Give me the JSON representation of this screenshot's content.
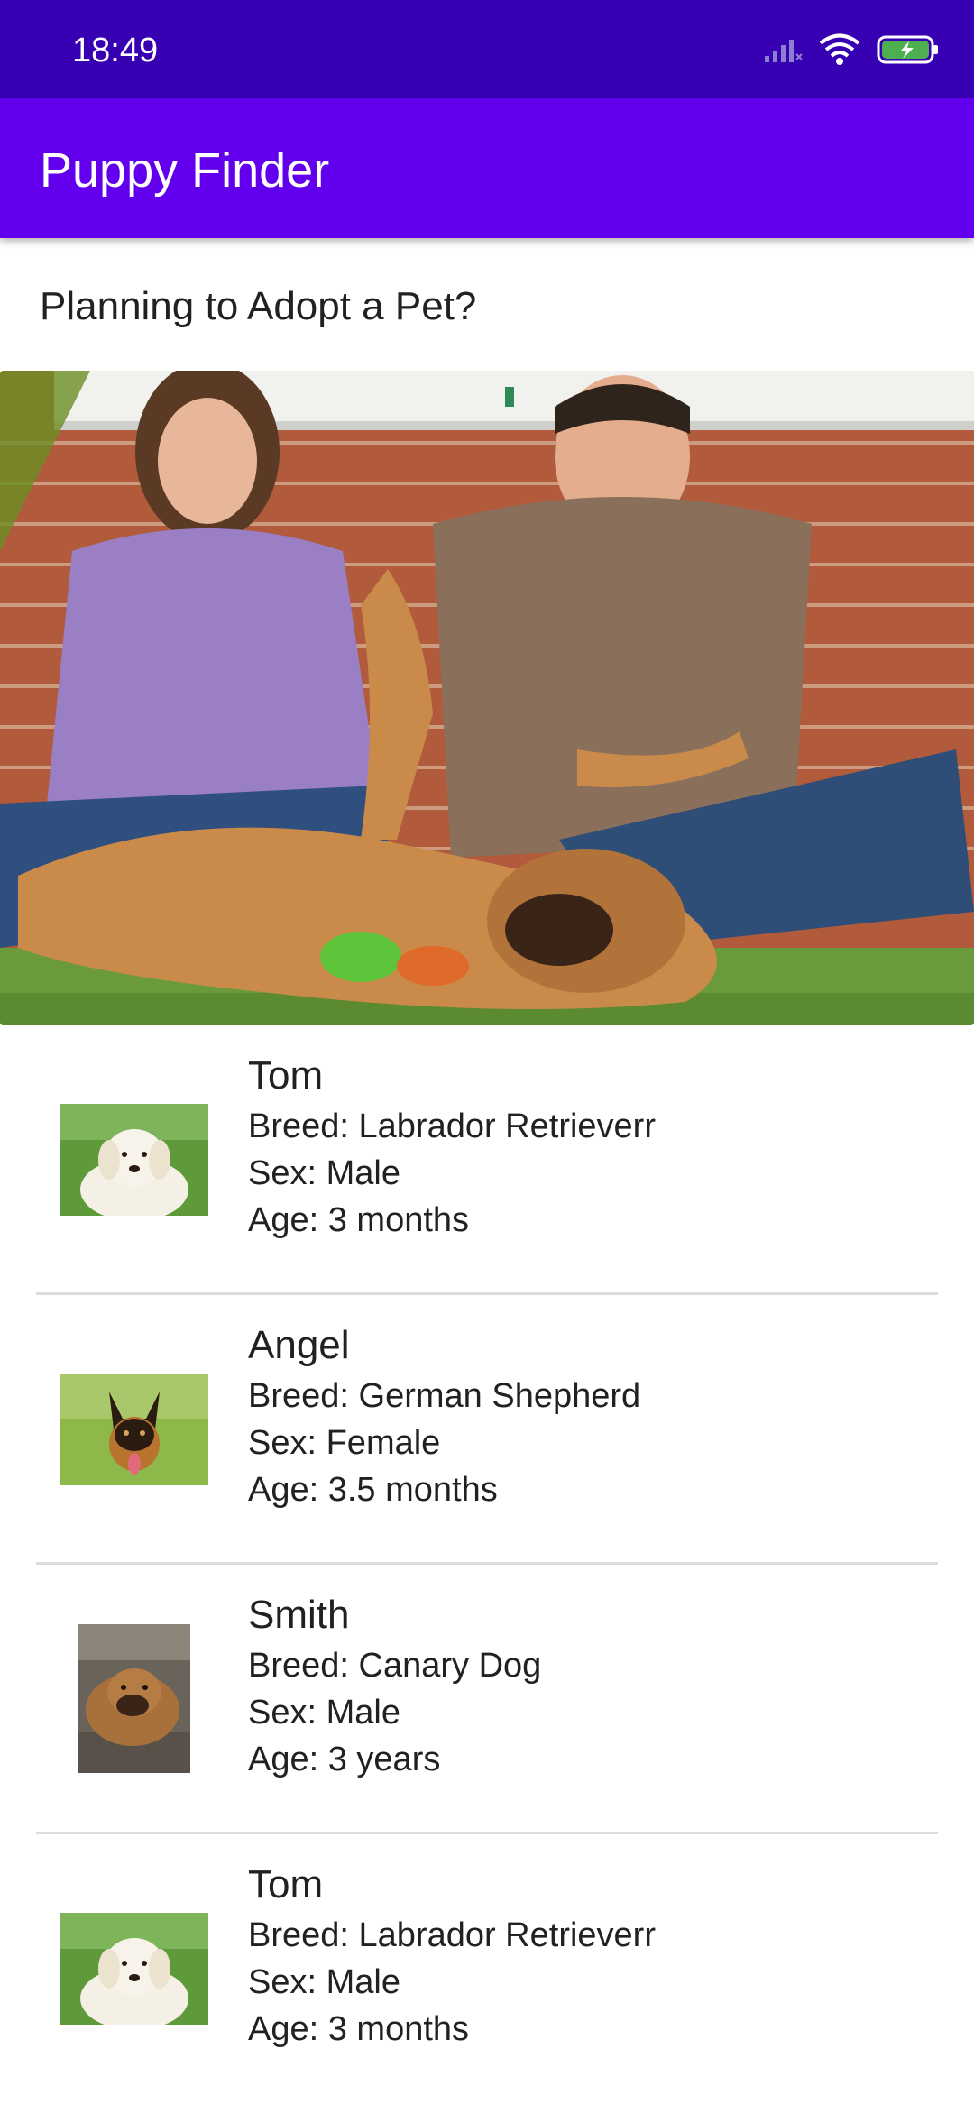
{
  "status_bar": {
    "time": "18:49",
    "icons": [
      "signal-icon",
      "wifi-icon",
      "battery-charging-icon"
    ]
  },
  "app_bar": {
    "title": "Puppy Finder"
  },
  "intro": {
    "heading": "Planning to Adopt a Pet?"
  },
  "pets": [
    {
      "name": "Tom",
      "breed": "Breed: Labrador Retrieverr",
      "sex": "Sex: Male",
      "age": "Age: 3 months"
    },
    {
      "name": "Angel",
      "breed": "Breed: German Shepherd",
      "sex": "Sex: Female",
      "age": "Age: 3.5 months"
    },
    {
      "name": "Smith",
      "breed": "Breed: Canary Dog",
      "sex": "Sex: Male",
      "age": "Age: 3 years"
    },
    {
      "name": "Tom",
      "breed": "Breed: Labrador Retrieverr",
      "sex": "Sex: Male",
      "age": "Age: 3 months"
    }
  ],
  "colors": {
    "status_bar": "#3700b3",
    "app_bar": "#6200ee",
    "battery": "#4caf50"
  }
}
